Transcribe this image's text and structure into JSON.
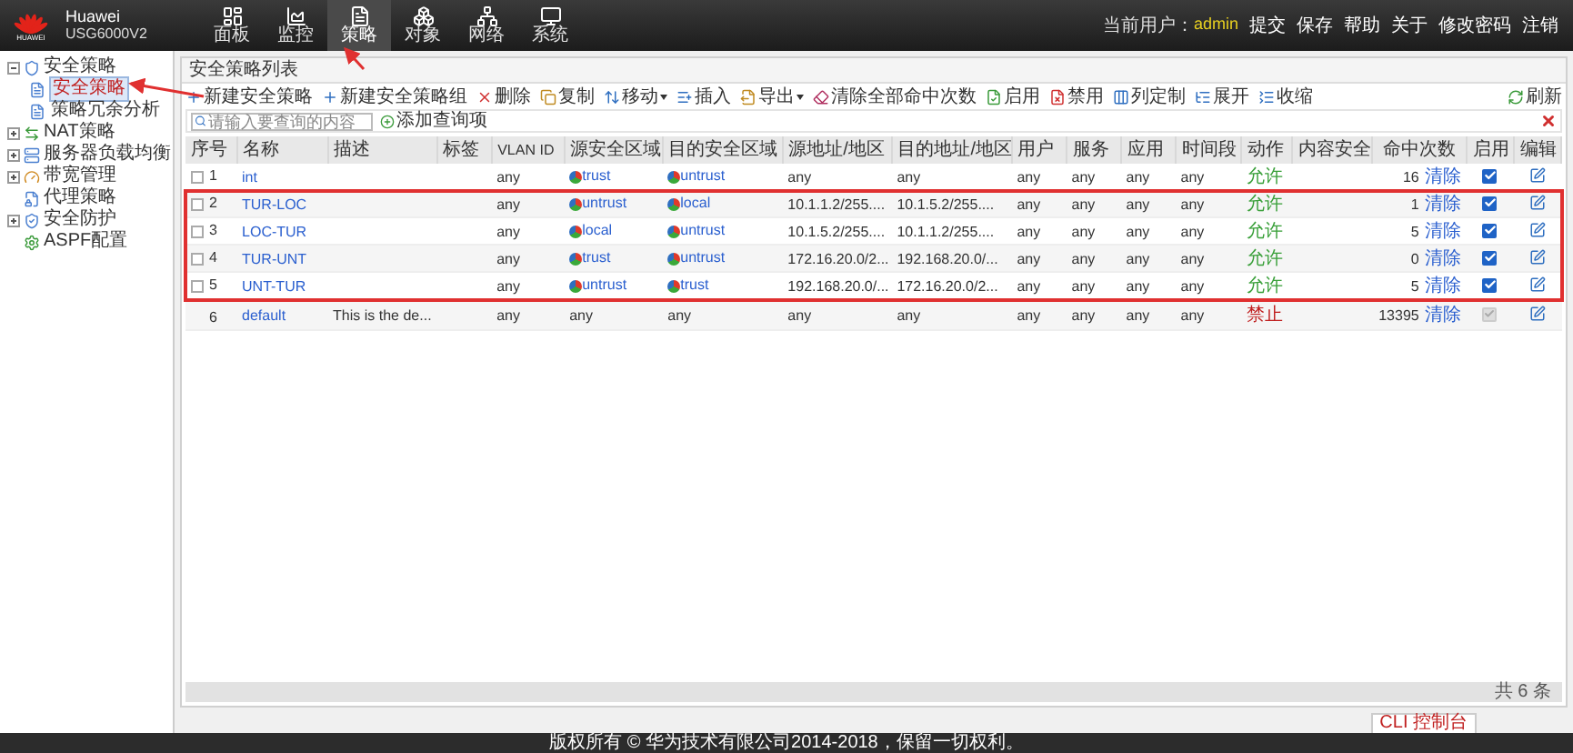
{
  "brand": {
    "logo_text": "HUAWEI",
    "name": "Huawei",
    "model": "USG6000V2"
  },
  "nav": [
    {
      "label": "面板",
      "selected": false
    },
    {
      "label": "监控",
      "selected": false
    },
    {
      "label": "策略",
      "selected": true
    },
    {
      "label": "对象",
      "selected": false
    },
    {
      "label": "网络",
      "selected": false
    },
    {
      "label": "系统",
      "selected": false
    }
  ],
  "user": {
    "label": "当前用户：",
    "name": "admin"
  },
  "top_links": [
    "提交",
    "保存",
    "帮助",
    "关于",
    "修改密码",
    "注销"
  ],
  "sidebar": {
    "items": [
      {
        "label": "安全策略",
        "kind": "group",
        "expanded": true,
        "children": [
          {
            "label": "安全策略",
            "selected": true
          },
          {
            "label": "策略冗余分析",
            "selected": false
          }
        ]
      },
      {
        "label": "NAT策略",
        "kind": "group",
        "expanded": false
      },
      {
        "label": "服务器负载均衡",
        "kind": "group",
        "expanded": false
      },
      {
        "label": "带宽管理",
        "kind": "group",
        "expanded": false
      },
      {
        "label": "代理策略",
        "kind": "leaf"
      },
      {
        "label": "安全防护",
        "kind": "group",
        "expanded": false
      },
      {
        "label": "ASPF配置",
        "kind": "leaf"
      }
    ]
  },
  "panel_title": "安全策略列表",
  "toolbar": [
    {
      "label": "新建安全策略",
      "menu": false
    },
    {
      "label": "新建安全策略组",
      "menu": false
    },
    {
      "label": "删除",
      "menu": false
    },
    {
      "label": "复制",
      "menu": false
    },
    {
      "label": "移动",
      "menu": true
    },
    {
      "label": "插入",
      "menu": false
    },
    {
      "label": "导出",
      "menu": true
    },
    {
      "label": "清除全部命中次数",
      "menu": false
    },
    {
      "label": "启用",
      "menu": false
    },
    {
      "label": "禁用",
      "menu": false
    },
    {
      "label": "列定制",
      "menu": false
    },
    {
      "label": "展开",
      "menu": false
    },
    {
      "label": "收缩",
      "menu": false
    }
  ],
  "refresh": "刷新",
  "search": {
    "placeholder": "请输入要查询的内容",
    "add_query": "添加查询项"
  },
  "table": {
    "columns": [
      "序号",
      "名称",
      "描述",
      "标签",
      "VLAN ID",
      "源安全区域",
      "目的安全区域",
      "源地址/地区",
      "目的地址/地区",
      "用户",
      "服务",
      "应用",
      "时间段",
      "动作",
      "内容安全",
      "命中次数",
      "启用",
      "编辑"
    ],
    "rows": [
      {
        "checked": false,
        "highlighted": false,
        "no": "1",
        "name": "int",
        "desc": "",
        "vlan": "any",
        "src_zone": "trust",
        "dst_zone": "untrust",
        "src_addr": "any",
        "dst_addr": "any",
        "user": "any",
        "service": "any",
        "app": "any",
        "time": "any",
        "action": {
          "text": "允许",
          "color": "#3aa03a"
        },
        "hits": "16",
        "clear": "清除",
        "enabled": {
          "checked": true,
          "disabled": false
        }
      },
      {
        "checked": false,
        "highlighted": true,
        "no": "2",
        "name": "TUR-LOC",
        "desc": "",
        "vlan": "any",
        "src_zone": "untrust",
        "dst_zone": "local",
        "src_addr": "10.1.1.2/255....",
        "dst_addr": "10.1.5.2/255....",
        "user": "any",
        "service": "any",
        "app": "any",
        "time": "any",
        "action": {
          "text": "允许",
          "color": "#3aa03a"
        },
        "hits": "1",
        "clear": "清除",
        "enabled": {
          "checked": true,
          "disabled": false
        }
      },
      {
        "checked": false,
        "highlighted": true,
        "no": "3",
        "name": "LOC-TUR",
        "desc": "",
        "vlan": "any",
        "src_zone": "local",
        "dst_zone": "untrust",
        "src_addr": "10.1.5.2/255....",
        "dst_addr": "10.1.1.2/255....",
        "user": "any",
        "service": "any",
        "app": "any",
        "time": "any",
        "action": {
          "text": "允许",
          "color": "#3aa03a"
        },
        "hits": "5",
        "clear": "清除",
        "enabled": {
          "checked": true,
          "disabled": false
        }
      },
      {
        "checked": false,
        "highlighted": true,
        "no": "4",
        "name": "TUR-UNT",
        "desc": "",
        "vlan": "any",
        "src_zone": "trust",
        "dst_zone": "untrust",
        "src_addr": "172.16.20.0/2...",
        "dst_addr": "192.168.20.0/...",
        "user": "any",
        "service": "any",
        "app": "any",
        "time": "any",
        "action": {
          "text": "允许",
          "color": "#3aa03a"
        },
        "hits": "0",
        "clear": "清除",
        "enabled": {
          "checked": true,
          "disabled": false
        }
      },
      {
        "checked": false,
        "highlighted": true,
        "no": "5",
        "name": "UNT-TUR",
        "desc": "",
        "vlan": "any",
        "src_zone": "untrust",
        "dst_zone": "trust",
        "src_addr": "192.168.20.0/...",
        "dst_addr": "172.16.20.0/2...",
        "user": "any",
        "service": "any",
        "app": "any",
        "time": "any",
        "action": {
          "text": "允许",
          "color": "#3aa03a"
        },
        "hits": "5",
        "clear": "清除",
        "enabled": {
          "checked": true,
          "disabled": false
        }
      },
      {
        "checked": null,
        "highlighted": false,
        "no": "6",
        "name": "default",
        "desc": "This is the de...",
        "vlan": "any",
        "src_zone": "any",
        "dst_zone": "any",
        "src_addr": "any",
        "dst_addr": "any",
        "user": "any",
        "service": "any",
        "app": "any",
        "time": "any",
        "action": {
          "text": "禁止",
          "color": "#c02020"
        },
        "hits": "13395",
        "clear": "清除",
        "enabled": {
          "checked": true,
          "disabled": true
        }
      }
    ]
  },
  "total": "共 6 条",
  "cli_button": "CLI 控制台",
  "copyright": "版权所有 © 华为技术有限公司2014-2018，保留一切权利。"
}
